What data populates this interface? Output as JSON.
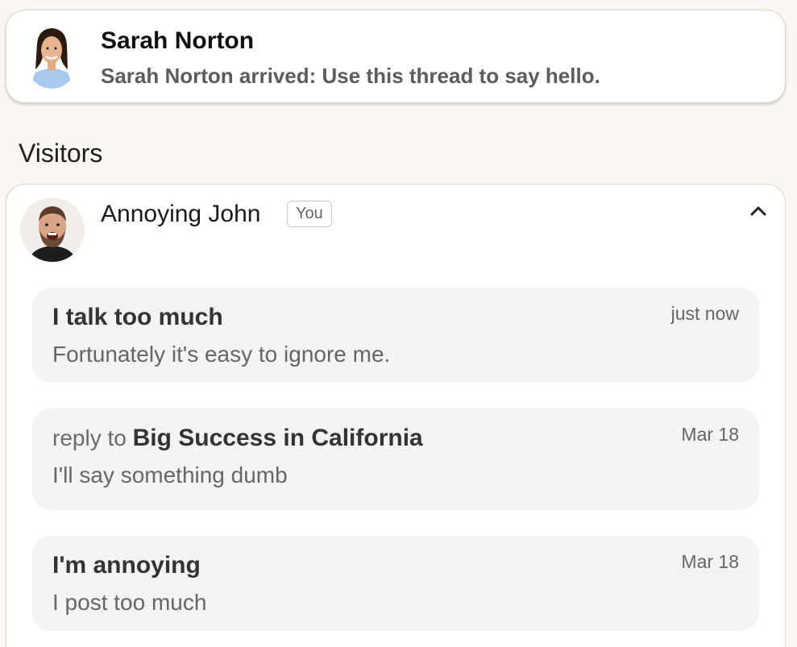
{
  "notification": {
    "name": "Sarah Norton",
    "message": "Sarah Norton arrived: Use this thread to say hello."
  },
  "visitors": {
    "section_title": "Visitors",
    "visitor": {
      "name": "Annoying John",
      "badge": "You"
    },
    "messages": [
      {
        "reply_prefix": "",
        "title": "I talk too much",
        "body": "Fortunately it's easy to ignore me.",
        "time": "just now"
      },
      {
        "reply_prefix": "reply to ",
        "title": "Big Success in California",
        "body": "I'll say something dumb",
        "time": "Mar 18"
      },
      {
        "reply_prefix": "",
        "title": "I'm annoying",
        "body": "I post too much",
        "time": "Mar 18"
      }
    ]
  },
  "icons": {
    "collapse": "chevron-up-icon"
  },
  "colors": {
    "page_bg": "#faf7f2",
    "card_bg": "#ffffff",
    "message_bg": "#f3f3f3"
  }
}
